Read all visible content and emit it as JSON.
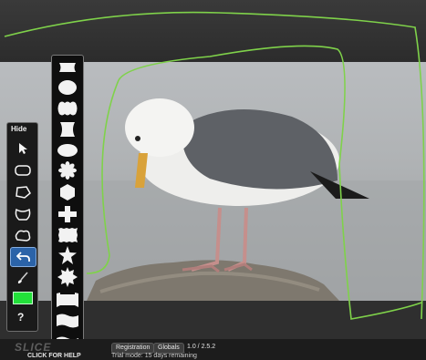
{
  "tool_panel": {
    "hide_label": "Hide",
    "tools": [
      {
        "name": "select-arrow-icon"
      },
      {
        "name": "rounded-rect-icon"
      },
      {
        "name": "polygon-icon"
      },
      {
        "name": "bag-shape-icon"
      },
      {
        "name": "cloud-shape-icon"
      },
      {
        "name": "undo-icon",
        "active": true
      },
      {
        "name": "brush-icon"
      }
    ],
    "color_swatch": "#22e03a",
    "help_label": "?"
  },
  "shape_palette": {
    "shapes": [
      "ticket",
      "oval",
      "scalloped-rect",
      "bracket-rect",
      "ellipse",
      "flower",
      "hexagon",
      "cross",
      "stamp",
      "star",
      "sunburst",
      "banner",
      "wave-rect",
      "wave-banner"
    ]
  },
  "selection_outline_color": "#7fd24a",
  "status": {
    "brand": "SLICE",
    "help_link": "CLICK FOR HELP",
    "registration_label": "Registration",
    "globals_label": "Globals",
    "version": "1.0 / 2.5.2",
    "trial_text": "Trial mode: 15 days remaining"
  }
}
